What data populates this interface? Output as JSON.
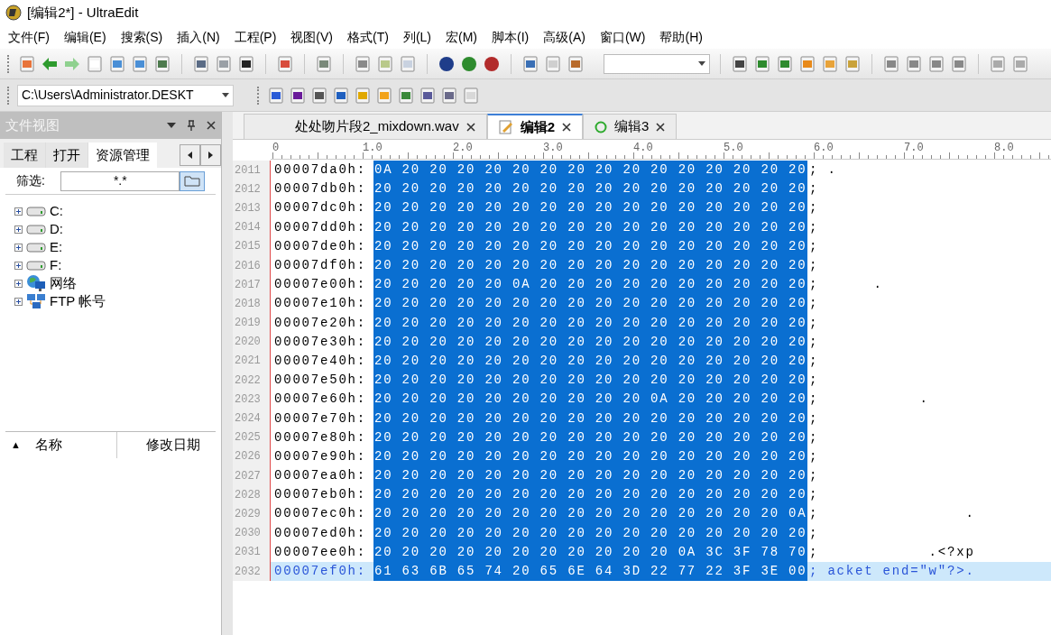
{
  "window": {
    "title": "[编辑2*] - UltraEdit"
  },
  "menu": [
    "文件(F)",
    "编辑(E)",
    "搜索(S)",
    "插入(N)",
    "工程(P)",
    "视图(V)",
    "格式(T)",
    "列(L)",
    "宏(M)",
    "脚本(I)",
    "高级(A)",
    "窗口(W)",
    "帮助(H)"
  ],
  "path_combo": {
    "value": "C:\\Users\\Administrator.DESKT"
  },
  "file_view": {
    "title": "文件视图",
    "tabs": [
      {
        "label": "工程",
        "selected": false
      },
      {
        "label": "打开",
        "selected": false
      },
      {
        "label": "资源管理",
        "selected": true
      }
    ],
    "filter": {
      "label": "筛选:",
      "value": "*.*"
    },
    "tree": [
      {
        "label": "C:",
        "kind": "drive",
        "expanded": false
      },
      {
        "label": "D:",
        "kind": "drive",
        "expanded": false
      },
      {
        "label": "E:",
        "kind": "drive",
        "expanded": false
      },
      {
        "label": "F:",
        "kind": "drive",
        "expanded": false
      },
      {
        "label": "网络",
        "kind": "network",
        "expanded": false
      },
      {
        "label": "FTP 帐号",
        "kind": "ftp",
        "expanded": false
      }
    ],
    "list_columns": [
      {
        "label": "名称",
        "sort": "▲"
      },
      {
        "label": "修改日期"
      }
    ]
  },
  "editor_tabs": [
    {
      "label": "处处吻片段2_mixdown.wav",
      "kind": "plain",
      "selected": false
    },
    {
      "label": "编辑2",
      "kind": "edited",
      "selected": true
    },
    {
      "label": "编辑3",
      "kind": "new",
      "selected": false
    }
  ],
  "ruler": [
    "0",
    "1.0",
    "2.0",
    "3.0",
    "4.0",
    "5.0",
    "6.0",
    "7.0",
    "8.0"
  ],
  "rows": [
    {
      "line": "2011",
      "address": "00007da0h:",
      "bytes": "0A 20 20 20 20 20 20 20 20 20 20 20 20 20 20 20",
      "ascii": "; .",
      "selected": true,
      "current": false
    },
    {
      "line": "2012",
      "address": "00007db0h:",
      "bytes": "20 20 20 20 20 20 20 20 20 20 20 20 20 20 20 20",
      "ascii": ";",
      "selected": true,
      "current": false
    },
    {
      "line": "2013",
      "address": "00007dc0h:",
      "bytes": "20 20 20 20 20 20 20 20 20 20 20 20 20 20 20 20",
      "ascii": ";",
      "selected": true,
      "current": false
    },
    {
      "line": "2014",
      "address": "00007dd0h:",
      "bytes": "20 20 20 20 20 20 20 20 20 20 20 20 20 20 20 20",
      "ascii": ";",
      "selected": true,
      "current": false
    },
    {
      "line": "2015",
      "address": "00007de0h:",
      "bytes": "20 20 20 20 20 20 20 20 20 20 20 20 20 20 20 20",
      "ascii": ";",
      "selected": true,
      "current": false
    },
    {
      "line": "2016",
      "address": "00007df0h:",
      "bytes": "20 20 20 20 20 20 20 20 20 20 20 20 20 20 20 20",
      "ascii": ";",
      "selected": true,
      "current": false
    },
    {
      "line": "2017",
      "address": "00007e00h:",
      "bytes": "20 20 20 20 20 0A 20 20 20 20 20 20 20 20 20 20",
      "ascii": ";      .",
      "selected": true,
      "current": false
    },
    {
      "line": "2018",
      "address": "00007e10h:",
      "bytes": "20 20 20 20 20 20 20 20 20 20 20 20 20 20 20 20",
      "ascii": ";",
      "selected": true,
      "current": false
    },
    {
      "line": "2019",
      "address": "00007e20h:",
      "bytes": "20 20 20 20 20 20 20 20 20 20 20 20 20 20 20 20",
      "ascii": ";",
      "selected": true,
      "current": false
    },
    {
      "line": "2020",
      "address": "00007e30h:",
      "bytes": "20 20 20 20 20 20 20 20 20 20 20 20 20 20 20 20",
      "ascii": ";",
      "selected": true,
      "current": false
    },
    {
      "line": "2021",
      "address": "00007e40h:",
      "bytes": "20 20 20 20 20 20 20 20 20 20 20 20 20 20 20 20",
      "ascii": ";",
      "selected": true,
      "current": false
    },
    {
      "line": "2022",
      "address": "00007e50h:",
      "bytes": "20 20 20 20 20 20 20 20 20 20 20 20 20 20 20 20",
      "ascii": ";",
      "selected": true,
      "current": false
    },
    {
      "line": "2023",
      "address": "00007e60h:",
      "bytes": "20 20 20 20 20 20 20 20 20 20 0A 20 20 20 20 20",
      "ascii": ";           .",
      "selected": true,
      "current": false
    },
    {
      "line": "2024",
      "address": "00007e70h:",
      "bytes": "20 20 20 20 20 20 20 20 20 20 20 20 20 20 20 20",
      "ascii": ";",
      "selected": true,
      "current": false
    },
    {
      "line": "2025",
      "address": "00007e80h:",
      "bytes": "20 20 20 20 20 20 20 20 20 20 20 20 20 20 20 20",
      "ascii": ";",
      "selected": true,
      "current": false
    },
    {
      "line": "2026",
      "address": "00007e90h:",
      "bytes": "20 20 20 20 20 20 20 20 20 20 20 20 20 20 20 20",
      "ascii": ";",
      "selected": true,
      "current": false
    },
    {
      "line": "2027",
      "address": "00007ea0h:",
      "bytes": "20 20 20 20 20 20 20 20 20 20 20 20 20 20 20 20",
      "ascii": ";",
      "selected": true,
      "current": false
    },
    {
      "line": "2028",
      "address": "00007eb0h:",
      "bytes": "20 20 20 20 20 20 20 20 20 20 20 20 20 20 20 20",
      "ascii": ";",
      "selected": true,
      "current": false
    },
    {
      "line": "2029",
      "address": "00007ec0h:",
      "bytes": "20 20 20 20 20 20 20 20 20 20 20 20 20 20 20 0A",
      "ascii": ";                .",
      "selected": true,
      "current": false
    },
    {
      "line": "2030",
      "address": "00007ed0h:",
      "bytes": "20 20 20 20 20 20 20 20 20 20 20 20 20 20 20 20",
      "ascii": ";",
      "selected": true,
      "current": false
    },
    {
      "line": "2031",
      "address": "00007ee0h:",
      "bytes": "20 20 20 20 20 20 20 20 20 20 20 0A 3C 3F 78 70",
      "ascii": ";            .<?xp",
      "selected": true,
      "current": false
    },
    {
      "line": "2032",
      "address": "00007ef0h:",
      "bytes": "61 63 6B 65 74 20 65 6E 64 3D 22 77 22 3F 3E 00",
      "ascii": "; acket end=\"w\"?>.",
      "selected": true,
      "current": true
    }
  ]
}
